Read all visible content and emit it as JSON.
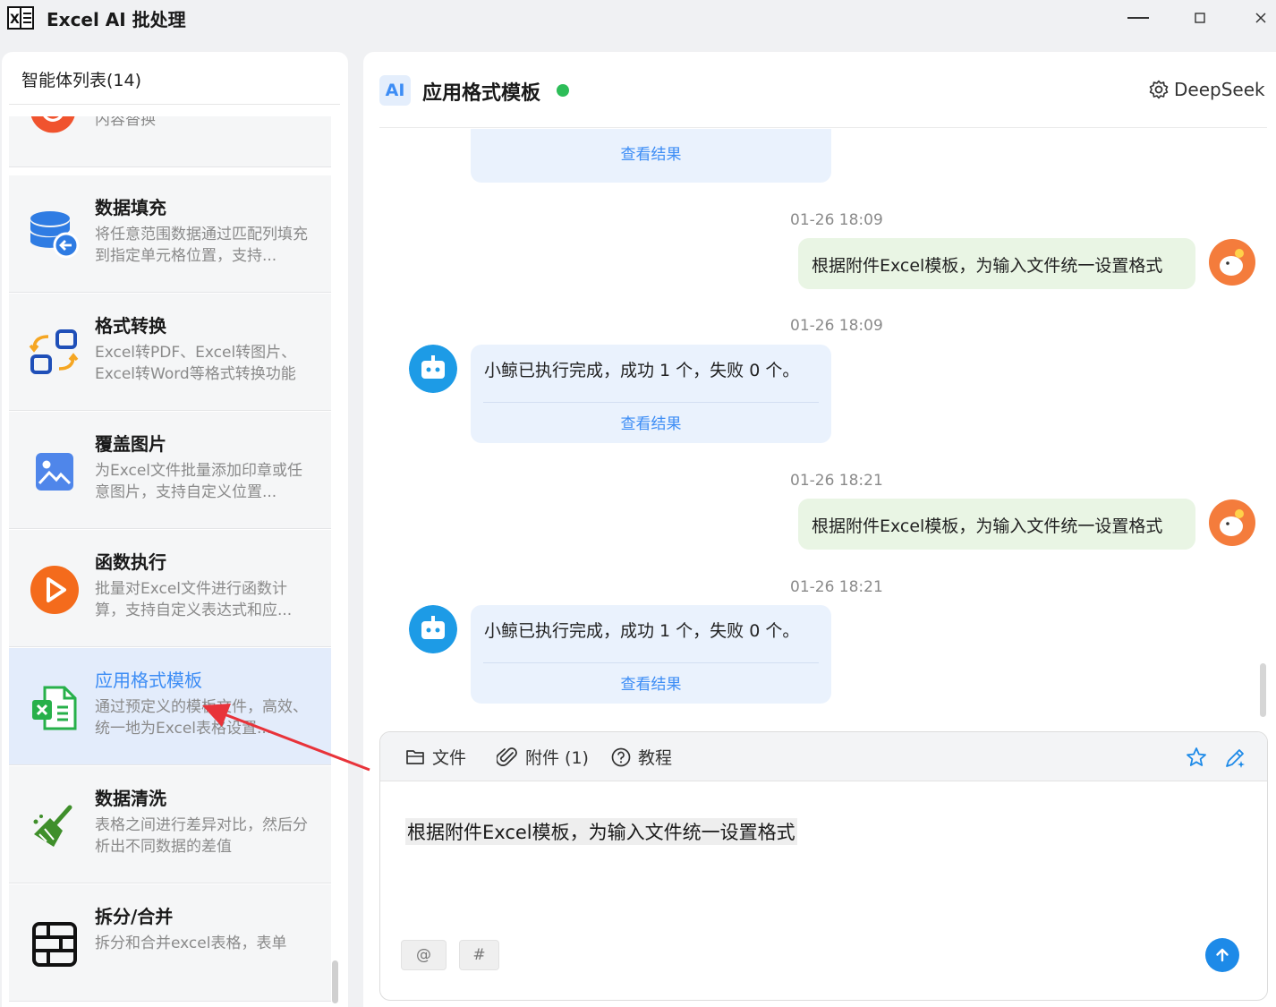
{
  "app": {
    "title": "Excel AI 批处理",
    "window_controls": [
      "minimize-icon",
      "maximize-icon",
      "close-icon"
    ]
  },
  "sidebar": {
    "header": "智能体列表(14)",
    "items": [
      {
        "name": "",
        "desc": "对多个Excel的任意单元格进行内容替换",
        "icon": "replace-icon",
        "color": "#f0532e"
      },
      {
        "name": "数据填充",
        "desc": "将任意范围数据通过匹配列填充到指定单元格位置，支持...",
        "icon": "database-fill-icon",
        "color": "#2f7ce3"
      },
      {
        "name": "格式转换",
        "desc": "Excel转PDF、Excel转图片、Excel转Word等格式转换功能",
        "icon": "format-convert-icon",
        "color": "#1f4fb8"
      },
      {
        "name": "覆盖图片",
        "desc": "为Excel文件批量添加印章或任意图片，支持自定义位置...",
        "icon": "image-icon",
        "color": "#4f86ea"
      },
      {
        "name": "函数执行",
        "desc": "批量对Excel文件进行函数计算，支持自定义表达式和应...",
        "icon": "play-icon",
        "color": "#f46b1c"
      },
      {
        "name": "应用格式模板",
        "desc": "通过预定义的模板文件，高效、统一地为Excel表格设置...",
        "icon": "excel-template-icon",
        "color": "#27b04a",
        "active": true
      },
      {
        "name": "数据清洗",
        "desc": "表格之间进行差异对比，然后分析出不同数据的差值",
        "icon": "broom-icon",
        "color": "#3f8f2b"
      },
      {
        "name": "拆分/合并",
        "desc": "拆分和合并excel表格，表单",
        "icon": "split-merge-icon",
        "color": "#111111"
      }
    ]
  },
  "chat": {
    "badge": "AI",
    "title": "应用格式模板",
    "status_color": "#2dbd58",
    "model": "DeepSeek",
    "view_result": "查看结果",
    "messages": [
      {
        "type": "bot-tail",
        "link": "查看结果"
      },
      {
        "type": "user",
        "time": "01-26 18:09",
        "text": "根据附件Excel模板，为输入文件统一设置格式"
      },
      {
        "type": "bot",
        "time": "01-26 18:09",
        "text": "小鲸已执行完成，成功 1 个，失败 0 个。",
        "link": "查看结果"
      },
      {
        "type": "user",
        "time": "01-26 18:21",
        "text": "根据附件Excel模板，为输入文件统一设置格式"
      },
      {
        "type": "bot",
        "time": "01-26 18:21",
        "text": "小鲸已执行完成，成功 1 个，失败 0 个。",
        "link": "查看结果"
      }
    ]
  },
  "composer": {
    "file": "文件",
    "attach": "附件 (1)",
    "tutorial": "教程",
    "input_text": "根据附件Excel模板，为输入文件统一设置格式",
    "at": "@",
    "hash": "#"
  },
  "colors": {
    "accent": "#3d8df5",
    "send": "#1d8ae8",
    "annotation_arrow": "#e8333a"
  }
}
